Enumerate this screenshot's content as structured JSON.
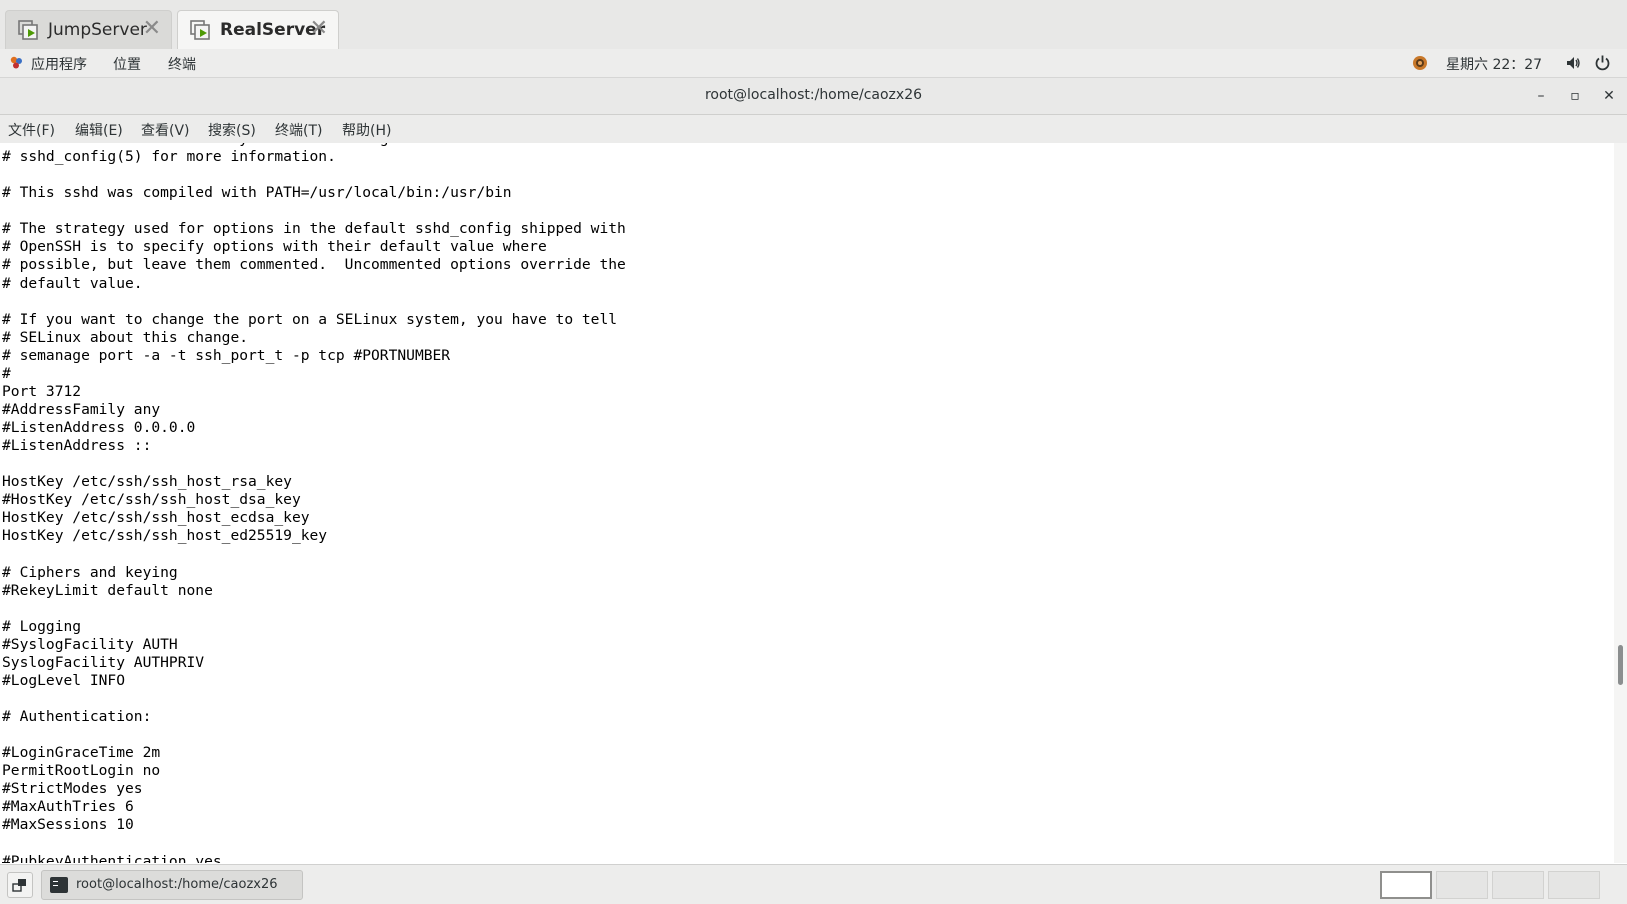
{
  "tabs": [
    {
      "label": "JumpServer",
      "active": false
    },
    {
      "label": "RealServer",
      "active": true
    }
  ],
  "topbar": {
    "apps_label": "应用程序",
    "places_label": "位置",
    "terminal_label": "终端",
    "clock": "星期六 22：27"
  },
  "window": {
    "title": "root@localhost:/home/caozx26",
    "minimize": "–",
    "maximize": "▫",
    "close": "✕"
  },
  "menubar": {
    "file": "文件(F)",
    "edit": "编辑(E)",
    "view": "查看(V)",
    "search": "搜索(S)",
    "terminal": "终端(T)",
    "help": "帮助(H)"
  },
  "terminal": {
    "lines": [
      "# This is the sshd server system-wide configuration file.  See",
      "# sshd_config(5) for more information.",
      "",
      "# This sshd was compiled with PATH=/usr/local/bin:/usr/bin",
      "",
      "# The strategy used for options in the default sshd_config shipped with",
      "# OpenSSH is to specify options with their default value where",
      "# possible, but leave them commented.  Uncommented options override the",
      "# default value.",
      "",
      "# If you want to change the port on a SELinux system, you have to tell",
      "# SELinux about this change.",
      "# semanage port -a -t ssh_port_t -p tcp #PORTNUMBER",
      "#",
      "Port 3712",
      "#AddressFamily any",
      "#ListenAddress 0.0.0.0",
      "#ListenAddress ::",
      "",
      "HostKey /etc/ssh/ssh_host_rsa_key",
      "#HostKey /etc/ssh/ssh_host_dsa_key",
      "HostKey /etc/ssh/ssh_host_ecdsa_key",
      "HostKey /etc/ssh/ssh_host_ed25519_key",
      "",
      "# Ciphers and keying",
      "#RekeyLimit default none",
      "",
      "# Logging",
      "#SyslogFacility AUTH",
      "SyslogFacility AUTHPRIV",
      "#LogLevel INFO",
      "",
      "# Authentication:",
      "",
      "#LoginGraceTime 2m",
      "PermitRootLogin no",
      "#StrictModes yes",
      "#MaxAuthTries 6",
      "#MaxSessions 10",
      "",
      "#PubkeyAuthentication yes"
    ]
  },
  "taskbar": {
    "window_label": "root@localhost:/home/caozx26"
  },
  "colors": {
    "accent_green": "#4e9a06",
    "chrome_bg": "#ededec",
    "terminal_bg": "#ffffff"
  }
}
